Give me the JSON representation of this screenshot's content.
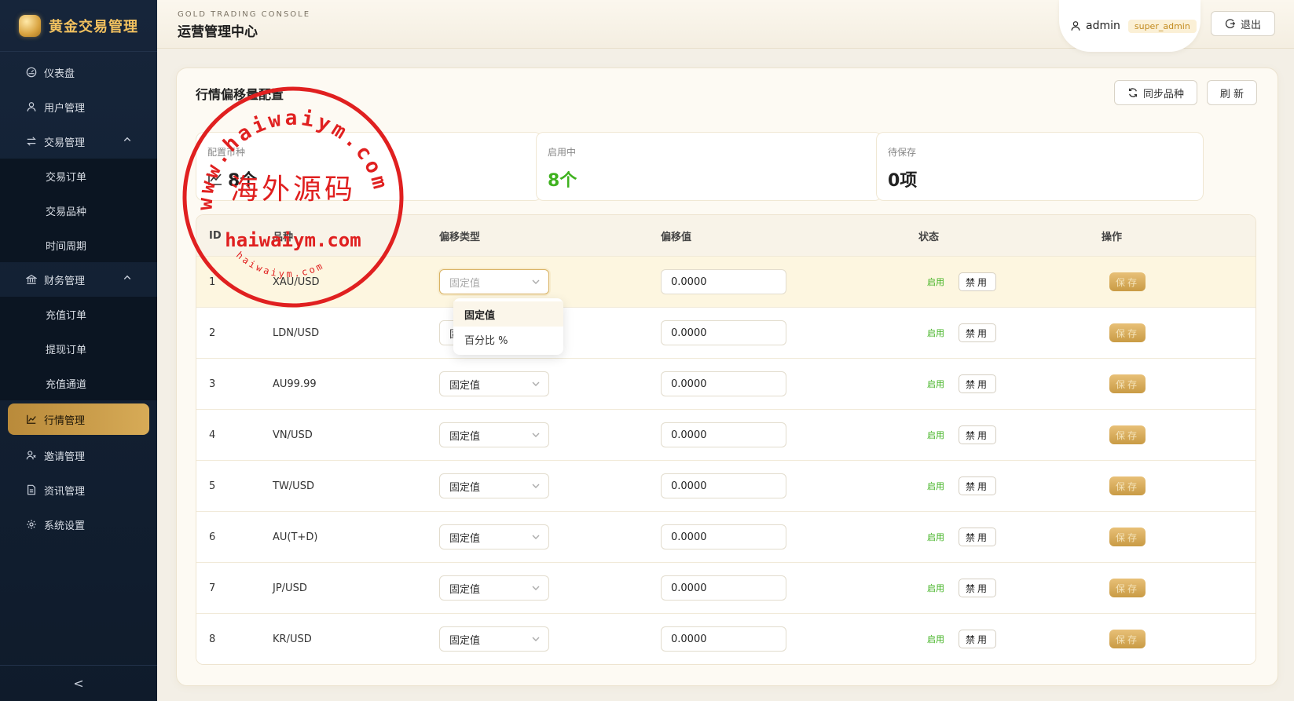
{
  "brand": {
    "title": "黄金交易管理"
  },
  "header": {
    "console_sub": "GOLD TRADING CONSOLE",
    "console_title": "运营管理中心",
    "user": {
      "name": "admin",
      "role": "super_admin"
    },
    "logout_label": "退出"
  },
  "sidebar": {
    "items": [
      {
        "label": "仪表盘",
        "icon": "dashboard-icon"
      },
      {
        "label": "用户管理",
        "icon": "user-icon"
      },
      {
        "label": "交易管理",
        "icon": "exchange-icon",
        "expanded": true,
        "children": [
          "交易订单",
          "交易品种",
          "时间周期"
        ]
      },
      {
        "label": "财务管理",
        "icon": "bank-icon",
        "expanded": true,
        "children": [
          "充值订单",
          "提现订单",
          "充值通道"
        ]
      },
      {
        "label": "行情管理",
        "icon": "chart-line-icon",
        "active": true
      },
      {
        "label": "邀请管理",
        "icon": "invite-icon"
      },
      {
        "label": "资讯管理",
        "icon": "document-icon"
      },
      {
        "label": "系统设置",
        "icon": "gear-icon"
      }
    ],
    "collapse_label": "<"
  },
  "page": {
    "title": "行情偏移量配置",
    "sync_label": "同步品种",
    "refresh_label": "刷 新"
  },
  "stats": [
    {
      "label": "配置币种",
      "value": "8个"
    },
    {
      "label": "启用中",
      "value": "8个",
      "color": "#3fb21f"
    },
    {
      "label": "待保存",
      "value": "0项"
    }
  ],
  "table": {
    "headers": {
      "id": "ID",
      "symbol": "品种",
      "type": "偏移类型",
      "value": "偏移值",
      "status": "状态",
      "op": "操作"
    },
    "rows": [
      {
        "id": "1",
        "symbol": "XAU/USD",
        "type": "固定值",
        "value": "0.0000",
        "status": "启用",
        "disable": "禁用",
        "save": "保存"
      },
      {
        "id": "2",
        "symbol": "LDN/USD",
        "type": "固定值",
        "value": "0.0000",
        "status": "启用",
        "disable": "禁用",
        "save": "保存"
      },
      {
        "id": "3",
        "symbol": "AU99.99",
        "type": "固定值",
        "value": "0.0000",
        "status": "启用",
        "disable": "禁用",
        "save": "保存"
      },
      {
        "id": "4",
        "symbol": "VN/USD",
        "type": "固定值",
        "value": "0.0000",
        "status": "启用",
        "disable": "禁用",
        "save": "保存"
      },
      {
        "id": "5",
        "symbol": "TW/USD",
        "type": "固定值",
        "value": "0.0000",
        "status": "启用",
        "disable": "禁用",
        "save": "保存"
      },
      {
        "id": "6",
        "symbol": "AU(T+D)",
        "type": "固定值",
        "value": "0.0000",
        "status": "启用",
        "disable": "禁用",
        "save": "保存"
      },
      {
        "id": "7",
        "symbol": "JP/USD",
        "type": "固定值",
        "value": "0.0000",
        "status": "启用",
        "disable": "禁用",
        "save": "保存"
      },
      {
        "id": "8",
        "symbol": "KR/USD",
        "type": "固定值",
        "value": "0.0000",
        "status": "启用",
        "disable": "禁用",
        "save": "保存"
      }
    ],
    "dropdown_options": [
      "固定值",
      "百分比 %"
    ]
  },
  "watermark": {
    "arc_text": "www.haiwaiym.com",
    "center_text": "海外源码",
    "domain_text": "haiwaiym.com",
    "small_text": "haiwaiym.com",
    "color": "#e02020"
  },
  "colors": {
    "accent": "#d7ab57",
    "sidebar_bg": "#16253a",
    "enabled": "#3fb21f"
  }
}
